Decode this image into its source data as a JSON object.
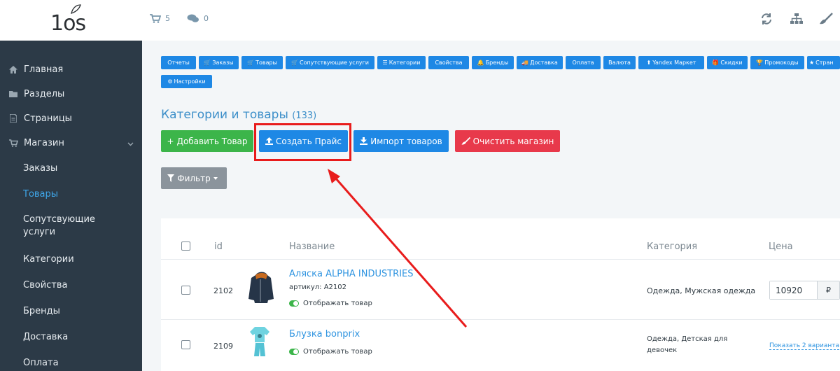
{
  "header": {
    "logo_text": "1os",
    "cart_count": "5",
    "comments_count": "0",
    "icons": [
      "refresh-icon",
      "sitemap-icon",
      "brush-icon"
    ]
  },
  "sidebar": {
    "items": [
      {
        "label": "Главная",
        "icon": "home-icon"
      },
      {
        "label": "Разделы",
        "icon": "folder-icon"
      },
      {
        "label": "Страницы",
        "icon": "file-icon"
      },
      {
        "label": "Магазин",
        "icon": "cart-icon"
      }
    ],
    "subitems": [
      "Заказы",
      "Товары",
      "Сопутсвующие услуги",
      "Категории",
      "Свойства",
      "Бренды",
      "Доставка",
      "Оплата"
    ],
    "active_subitem": "Товары"
  },
  "tabs": [
    "Отчеты",
    "Заказы",
    "Товары",
    "Сопутствующие услуги",
    "Категории",
    "Свойства",
    "Бренды",
    "Доставка",
    "Оплата",
    "Валюта",
    "Yandex Маркет",
    "Скидки",
    "Промокоды",
    "Стран",
    "Настройки"
  ],
  "page": {
    "title": "Категории и товары",
    "count": "(133)"
  },
  "buttons": {
    "add_product": "Добавить Товар",
    "create_price": "Создать Прайс",
    "import_products": "Импорт товаров",
    "clear_shop": "Очистить магазин",
    "filter": "Фильтр"
  },
  "table": {
    "headers": {
      "id": "id",
      "name": "Название",
      "category": "Категория",
      "price": "Цена"
    },
    "rows": [
      {
        "id": "2102",
        "name": "Аляска ALPHA INDUSTRIES",
        "sku": "артикул: A2102",
        "visible_label": "Отображать товар",
        "category": "Одежда, Мужская одежда",
        "price": "10920",
        "currency": "₽"
      },
      {
        "id": "2109",
        "name": "Блузка bonprix",
        "visible_label": "Отображать товар",
        "category": "Одежда, Детская для девочек",
        "variants_link": "Показать 2 варианта"
      }
    ]
  },
  "colors": {
    "sidebar_bg": "#2c3a47",
    "accent_blue": "#1e88e5",
    "green": "#3cb54a",
    "red": "#e8394b",
    "highlight": "#e81c1c"
  }
}
